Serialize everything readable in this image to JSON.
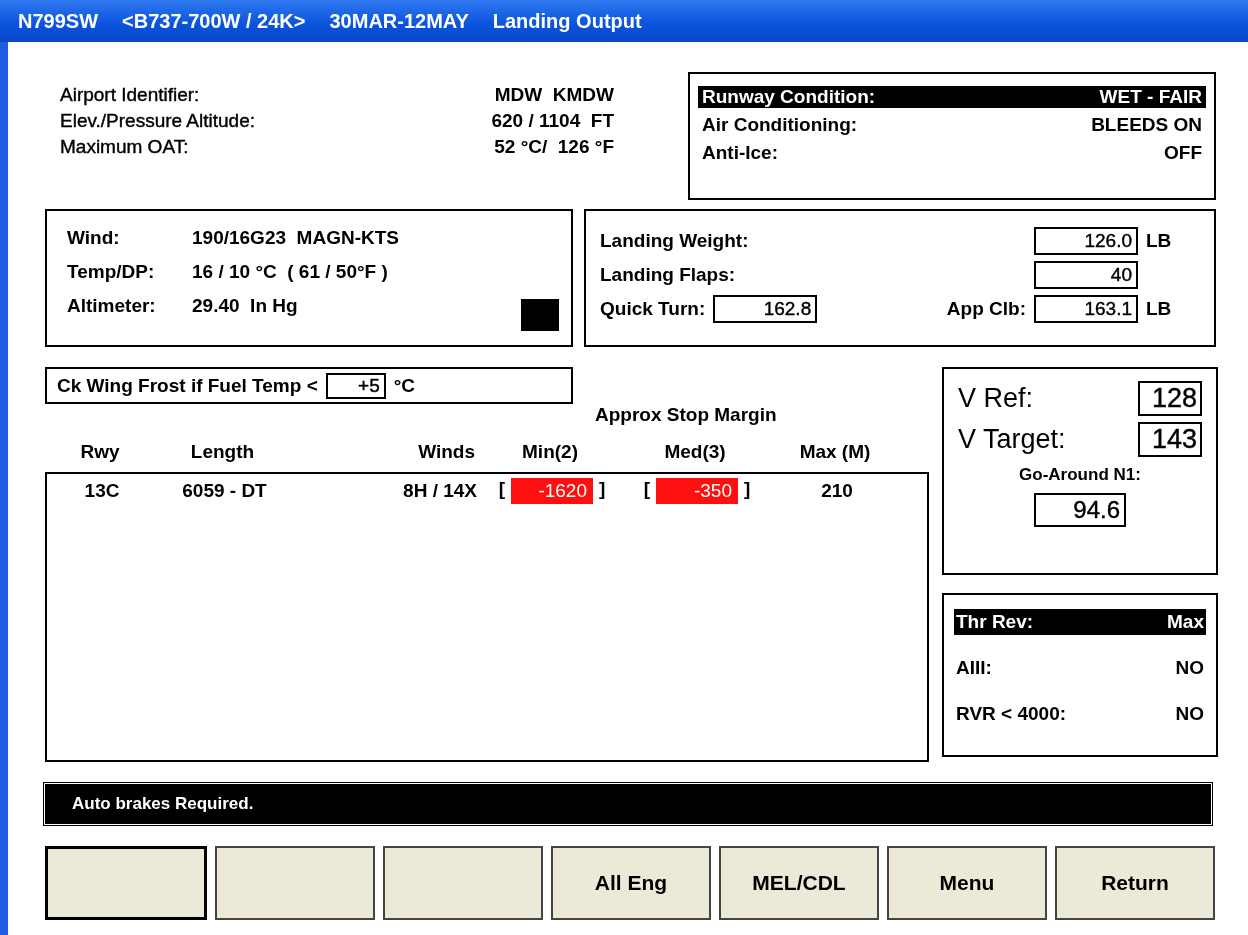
{
  "window": {
    "title_parts": [
      "N799SW",
      "<B737-700W / 24K>",
      "30MAR-12MAY",
      "Landing Output"
    ]
  },
  "airport": [
    {
      "label": "Airport Identifier:",
      "value": "MDW  KMDW"
    },
    {
      "label": "Elev./Pressure Altitude:",
      "value": "620 / 1104  FT"
    },
    {
      "label": "Maximum OAT:",
      "value": "52 °C/  126 °F"
    }
  ],
  "conditions": [
    {
      "label": "Runway Condition:",
      "value": "WET - FAIR",
      "selected": true
    },
    {
      "label": "Air Conditioning:",
      "value": "BLEEDS ON",
      "selected": false
    },
    {
      "label": "Anti-Ice:",
      "value": "OFF",
      "selected": false
    }
  ],
  "weather": [
    {
      "label": "Wind:",
      "value": "190/16G23  MAGN-KTS"
    },
    {
      "label": "Temp/DP:",
      "value": "16 / 10 °C  ( 61 / 50°F )"
    },
    {
      "label": "Altimeter:",
      "value": "29.40  In Hg"
    }
  ],
  "landing": {
    "weight_label": "Landing Weight:",
    "weight": "126.0",
    "weight_unit": "LB",
    "flaps_label": "Landing Flaps:",
    "flaps": "40",
    "quick_turn_label": "Quick Turn:",
    "quick_turn": "162.8",
    "app_clb_label": "App Clb:",
    "app_clb": "163.1",
    "app_clb_unit": "LB"
  },
  "frost": {
    "label": "Ck Wing Frost if Fuel Temp <",
    "value": "+5",
    "unit": "°C"
  },
  "table": {
    "group_heading": "Approx Stop Margin",
    "columns": [
      "Rwy",
      "Length",
      "Winds",
      "Min(2)",
      "Med(3)",
      "Max (M)"
    ],
    "rows": [
      {
        "rwy": "13C",
        "length": "6059 - DT",
        "winds": "8H / 14X",
        "min": {
          "open": "[",
          "value": "-1620",
          "close": "]",
          "alert": true
        },
        "med": {
          "open": "[",
          "value": "-350",
          "close": "]",
          "alert": true
        },
        "max": "210"
      }
    ]
  },
  "speeds": {
    "vref_label": "V Ref:",
    "vref": "128",
    "vtarget_label": "V Target:",
    "vtarget": "143",
    "n1_label": "Go-Around N1:",
    "n1": "94.6"
  },
  "options": [
    {
      "label": "Thr Rev:",
      "value": "Max",
      "selected": true
    },
    {
      "label": "AIII:",
      "value": "NO",
      "selected": false
    },
    {
      "label": "RVR < 4000:",
      "value": "NO",
      "selected": false
    }
  ],
  "status_bar": "Auto brakes Required.",
  "buttons": [
    {
      "focused": true
    },
    {
      "focused": false
    },
    {
      "focused": false
    },
    {
      "label": "All Eng",
      "focused": false
    },
    {
      "label": "MEL/CDL",
      "focused": false
    },
    {
      "label": "Menu",
      "focused": false
    },
    {
      "label": "Return",
      "focused": false
    }
  ]
}
